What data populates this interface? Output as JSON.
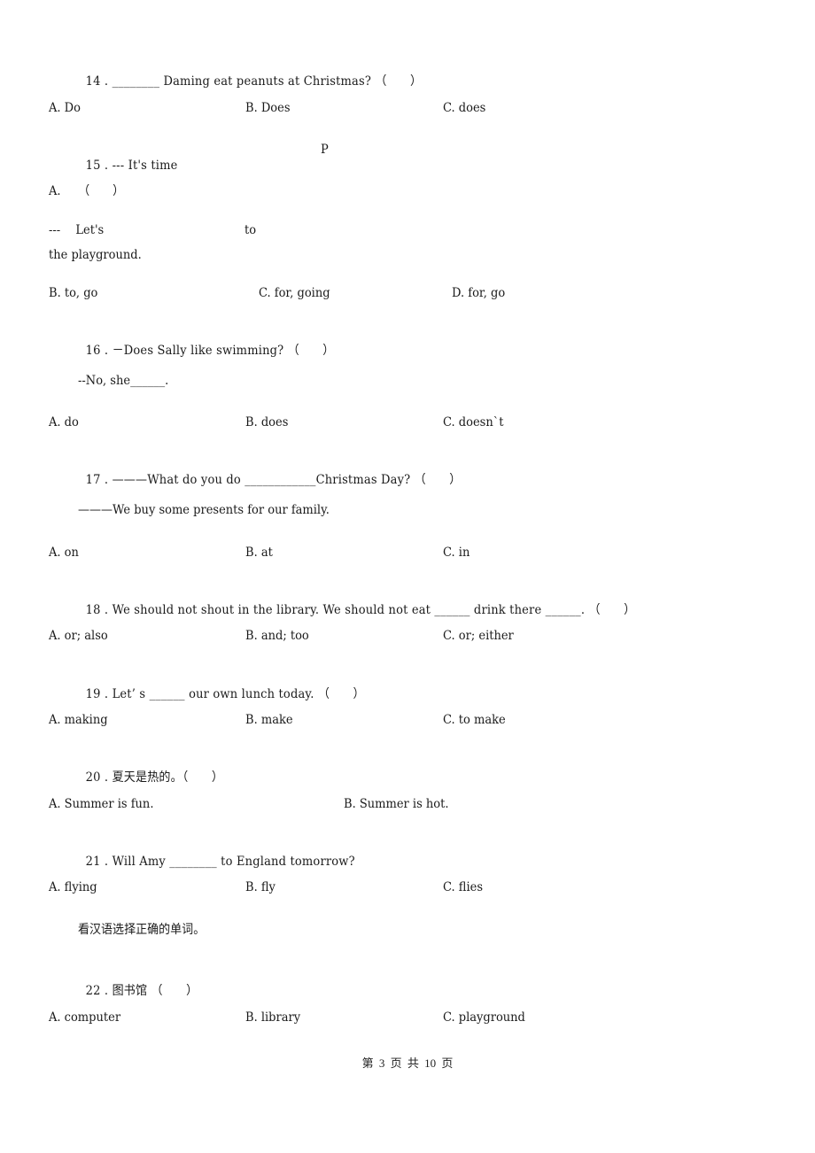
{
  "questions": {
    "q14": {
      "number": "14 .",
      "text": "________ Daming eat peanuts at Christmas? （　　）",
      "options": [
        "A. Do",
        "B. Does",
        "C. does"
      ]
    },
    "q15": {
      "number": "15 .",
      "text": "--- It's time",
      "fragment_p": "P",
      "line_a": "A.　　（　　）",
      "line_dialog": "---　 Let's",
      "fragment_to": "to",
      "line_continuation": "the playground.",
      "options": [
        "B. to, go",
        "C. for, going",
        "D. for, go"
      ]
    },
    "q16": {
      "number": "16 .",
      "text": "－Does Sally like swimming? （　　）",
      "answer_line": "--No, she______.",
      "options": [
        "A. do",
        "B. does",
        "C. doesn`t"
      ]
    },
    "q17": {
      "number": "17 .",
      "text": "———What do you do ____________Christmas Day? （　　）",
      "answer_line": "———We buy some presents for our family.",
      "options": [
        "A. on",
        "B. at",
        "C. in"
      ]
    },
    "q18": {
      "number": "18 .",
      "text": "We should not shout in the library. We should not eat ______ drink there ______. （　　）",
      "options": [
        "A. or; also",
        "B. and; too",
        "C. or; either"
      ]
    },
    "q19": {
      "number": "19 .",
      "text": "Let’ s ______ our own lunch today. （　　）",
      "options": [
        "A. making",
        "B. make",
        "C. to make"
      ]
    },
    "q20": {
      "number": "20 .",
      "text": "夏天是热的。（　　）",
      "options": [
        "A. Summer is fun.",
        "B. Summer is hot."
      ]
    },
    "q21": {
      "number": "21 .",
      "text": "Will Amy ________ to England tomorrow?",
      "options": [
        "A. flying",
        "B. fly",
        "C. flies"
      ]
    },
    "section_instruction": "看汉语选择正确的单词。",
    "q22": {
      "number": "22 .",
      "text": "图书馆 （　　）",
      "options": [
        "A. computer",
        "B. library",
        "C. playground"
      ]
    }
  },
  "footer": {
    "page_label": "第 3 页 共 10 页"
  }
}
